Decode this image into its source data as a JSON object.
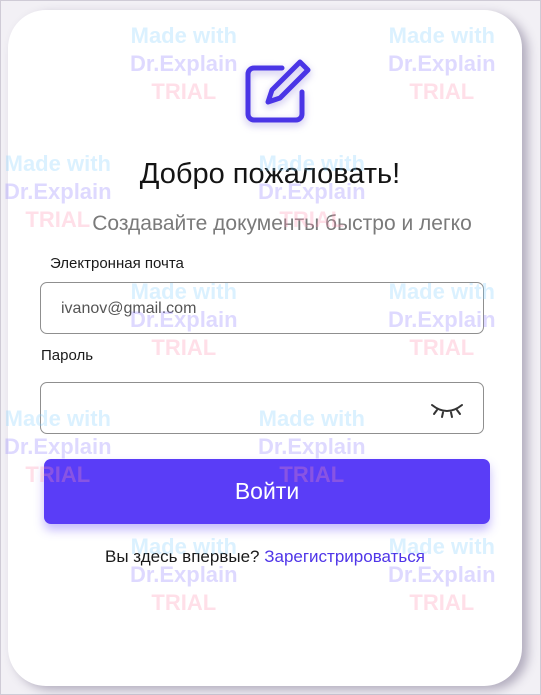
{
  "header": {
    "logo_icon": "edit-icon",
    "title": "Добро пожаловать!",
    "subtitle": "Создавайте документы быстро и легко"
  },
  "form": {
    "email_label": "Электронная почта",
    "email_value": "ivanov@gmail.com",
    "password_label": "Пароль",
    "password_value": "",
    "password_toggle_icon": "eye-closed-icon",
    "submit_label": "Войти"
  },
  "footer": {
    "prompt": "Вы здесь впервые?",
    "register_link": "Зарегистрироваться"
  },
  "watermark": {
    "line1": "Made with",
    "line2": "Dr.Explain",
    "line3": "TRIAL"
  },
  "colors": {
    "accent": "#5a3df7",
    "link": "#4f35e8",
    "background": "#f2f0f5",
    "card": "#ffffff"
  }
}
